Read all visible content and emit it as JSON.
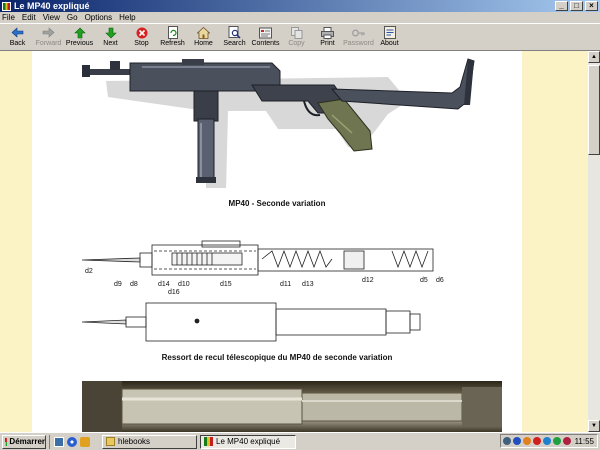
{
  "window": {
    "title": "Le MP40 expliqué",
    "controls": {
      "minimize": "_",
      "maximize": "□",
      "close": "×"
    }
  },
  "menu": [
    "File",
    "Edit",
    "View",
    "Go",
    "Options",
    "Help"
  ],
  "toolbar": [
    {
      "label": "Back",
      "icon": "back-arrow-icon",
      "enabled": true
    },
    {
      "label": "Forward",
      "icon": "forward-arrow-icon",
      "enabled": false
    },
    {
      "label": "Previous",
      "icon": "up-arrow-icon",
      "enabled": true
    },
    {
      "label": "Next",
      "icon": "down-arrow-icon",
      "enabled": true
    },
    {
      "label": "Stop",
      "icon": "stop-icon",
      "enabled": true
    },
    {
      "label": "Refresh",
      "icon": "refresh-icon",
      "enabled": true
    },
    {
      "label": "Home",
      "icon": "home-icon",
      "enabled": true
    },
    {
      "label": "Search",
      "icon": "search-icon",
      "enabled": true
    },
    {
      "label": "Contents",
      "icon": "contents-icon",
      "enabled": true
    },
    {
      "label": "Copy",
      "icon": "copy-icon",
      "enabled": false
    },
    {
      "label": "Print",
      "icon": "print-icon",
      "enabled": true
    },
    {
      "label": "Password",
      "icon": "key-icon",
      "enabled": false
    },
    {
      "label": "About",
      "icon": "about-icon",
      "enabled": true
    }
  ],
  "page": {
    "caption_gun": "MP40 - Seconde variation",
    "caption_spring": "Ressort de recul télescopique du MP40 de seconde variation",
    "drawing_labels": [
      "d2",
      "d9",
      "d8",
      "d14",
      "d10",
      "d16",
      "d15",
      "d11",
      "d13",
      "d12",
      "d5",
      "d6"
    ]
  },
  "taskbar": {
    "start": "Démarrer",
    "tasks": [
      {
        "label": "hlebooks",
        "active": false
      },
      {
        "label": "Le MP40 expliqué",
        "active": true
      }
    ],
    "clock": "11:55"
  },
  "colors": {
    "titlebar_start": "#0a246a",
    "titlebar_end": "#a6caf0",
    "content_background": "#fbf3c6",
    "page_background": "#ffffff",
    "chrome": "#d4d0c8"
  }
}
